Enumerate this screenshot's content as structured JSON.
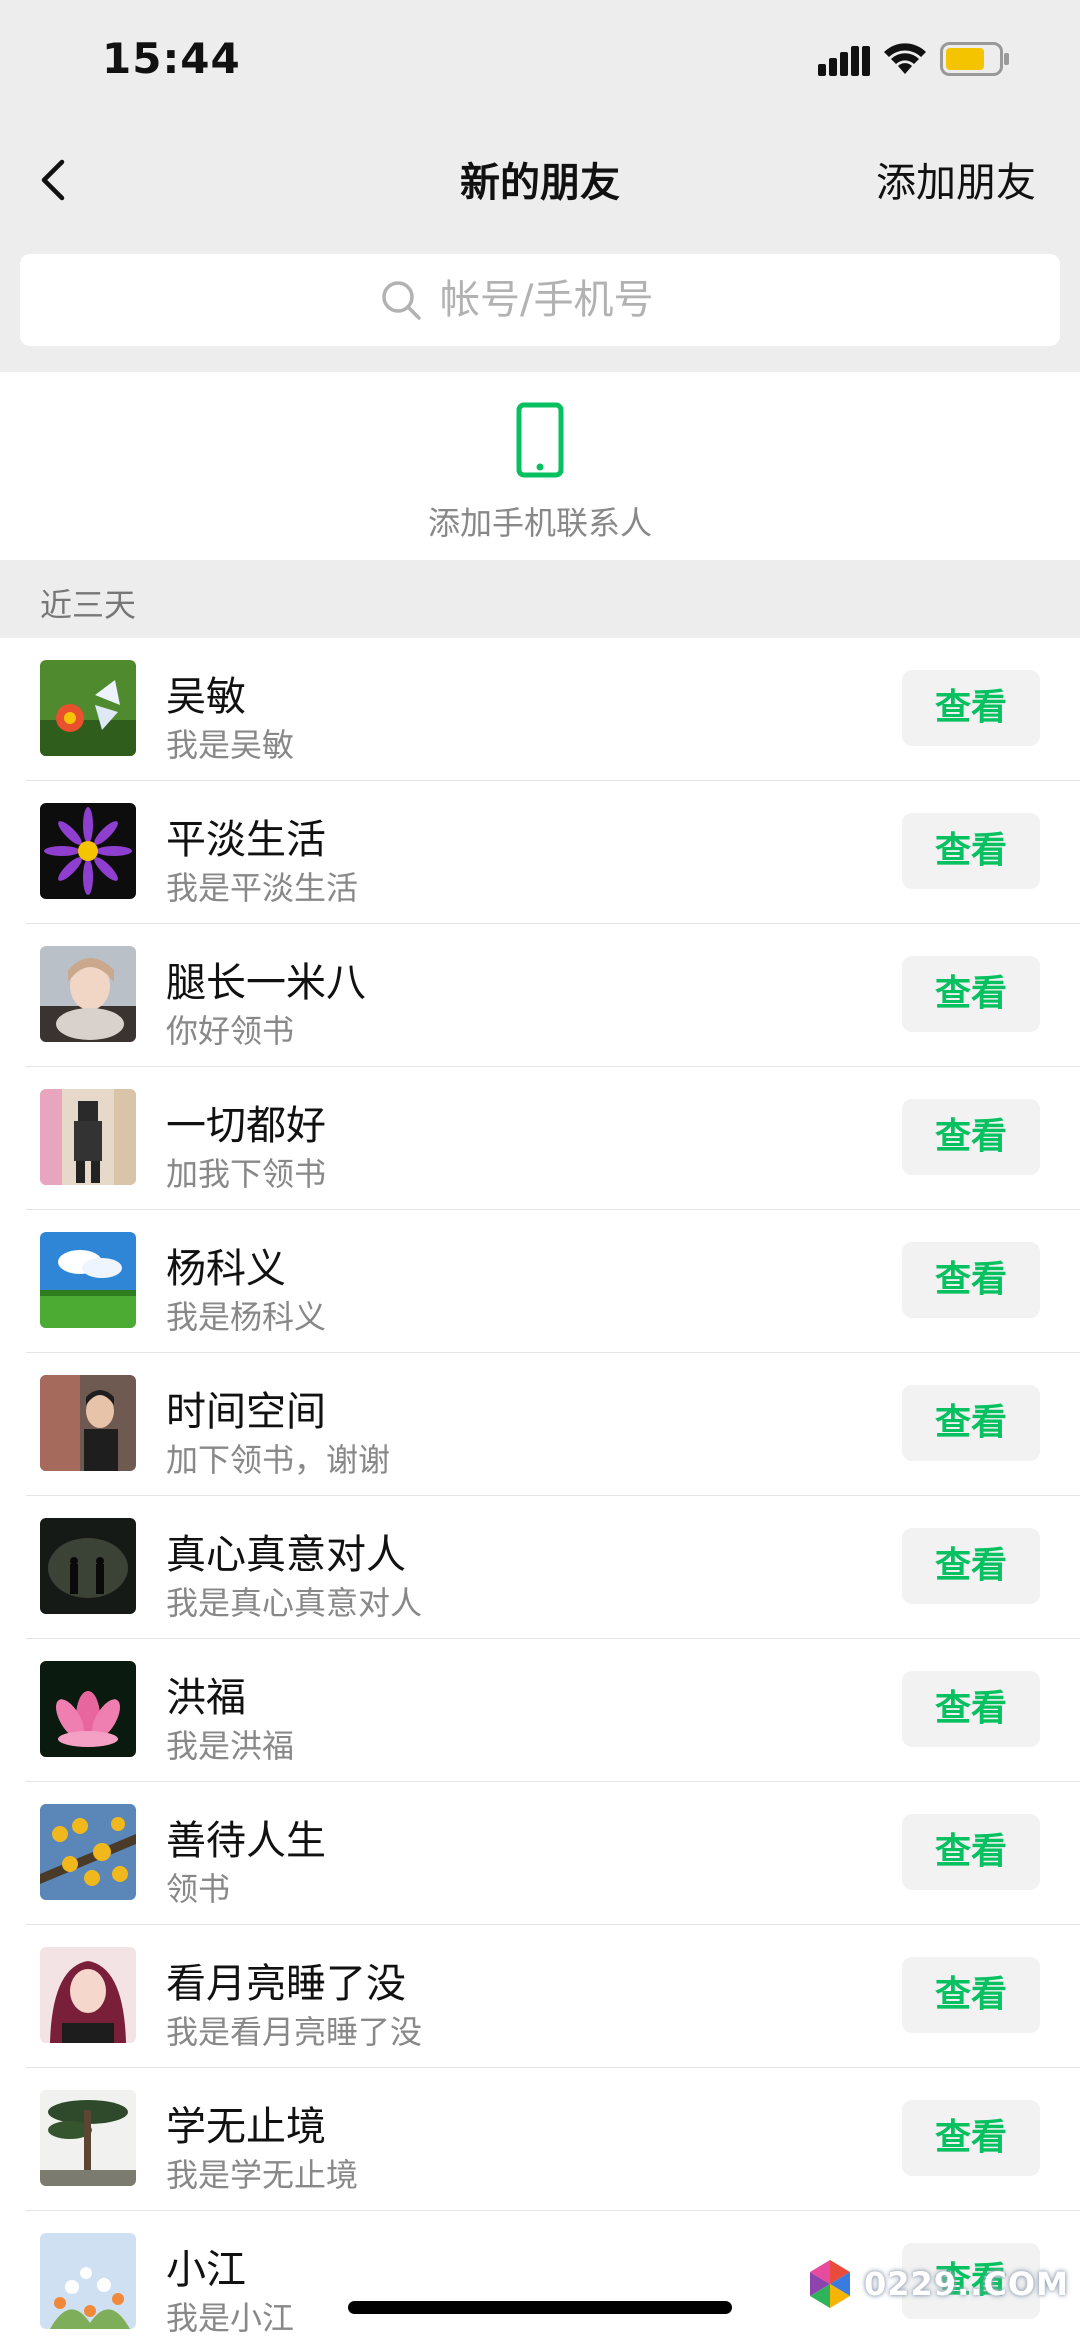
{
  "status_bar": {
    "time": "15:44"
  },
  "nav": {
    "title": "新的朋友",
    "action": "添加朋友"
  },
  "search": {
    "placeholder": "帐号/手机号"
  },
  "add_contacts": {
    "label": "添加手机联系人"
  },
  "section": {
    "title": "近三天"
  },
  "colors": {
    "accent": "#07c160",
    "battery": "#f5c400"
  },
  "friends": [
    {
      "name": "吴敏",
      "message": "我是吴敏",
      "button": "查看"
    },
    {
      "name": "平淡生活",
      "message": "我是平淡生活",
      "button": "查看"
    },
    {
      "name": "腿长一米八",
      "message": "你好领书",
      "button": "查看"
    },
    {
      "name": "一切都好",
      "message": "加我下领书",
      "button": "查看"
    },
    {
      "name": "杨科义",
      "message": "我是杨科义",
      "button": "查看"
    },
    {
      "name": "时间空间",
      "message": "加下领书，谢谢",
      "button": "查看"
    },
    {
      "name": "真心真意对人",
      "message": "我是真心真意对人",
      "button": "查看"
    },
    {
      "name": "洪福",
      "message": "我是洪福",
      "button": "查看"
    },
    {
      "name": "善待人生",
      "message": "领书",
      "button": "查看"
    },
    {
      "name": "看月亮睡了没",
      "message": "我是看月亮睡了没",
      "button": "查看"
    },
    {
      "name": "学无止境",
      "message": "我是学无止境",
      "button": "查看"
    },
    {
      "name": "小江",
      "message": "我是小江",
      "button": "查看"
    }
  ],
  "watermark": {
    "text": "0229..COM"
  }
}
